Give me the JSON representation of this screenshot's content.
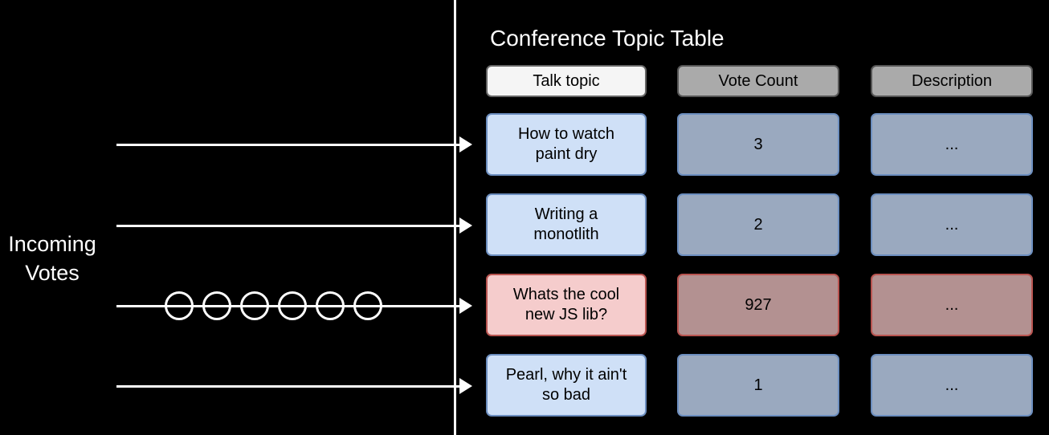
{
  "left_panel": {
    "label": "Incoming\nVotes",
    "queue_circle_count": 6,
    "feed_arrows": 4
  },
  "divider": {
    "color": "#ffffff"
  },
  "table": {
    "title": "Conference Topic Table",
    "columns": [
      {
        "key": "topic",
        "header": "Talk topic",
        "header_bg": "#f5f5f5",
        "header_border": "#666666"
      },
      {
        "key": "votes",
        "header": "Vote Count",
        "header_bg": "#aaaaaa",
        "header_border": "#555555"
      },
      {
        "key": "description",
        "header": "Description",
        "header_bg": "#aaaaaa",
        "header_border": "#555555"
      }
    ],
    "rows": [
      {
        "topic": "How to watch\npaint dry",
        "votes": "3",
        "description": "...",
        "highlight": false
      },
      {
        "topic": "Writing a\nmonotlith",
        "votes": "2",
        "description": "...",
        "highlight": false
      },
      {
        "topic": "Whats the cool\nnew JS lib?",
        "votes": "927",
        "description": "...",
        "highlight": true
      },
      {
        "topic": "Pearl, why it ain't\nso bad",
        "votes": "1",
        "description": "...",
        "highlight": false
      }
    ],
    "colors": {
      "topic_bg": "#cfe0f7",
      "topic_border": "#6c8ebf",
      "data_bg": "#9aa9bf",
      "data_border": "#6c8ebf",
      "highlight_topic_bg": "#f5cccc",
      "highlight_topic_border": "#b85450",
      "highlight_data_bg": "#b39191",
      "highlight_data_border": "#b85450",
      "background": "#000000",
      "text": "#000000",
      "title_text": "#ffffff"
    }
  }
}
